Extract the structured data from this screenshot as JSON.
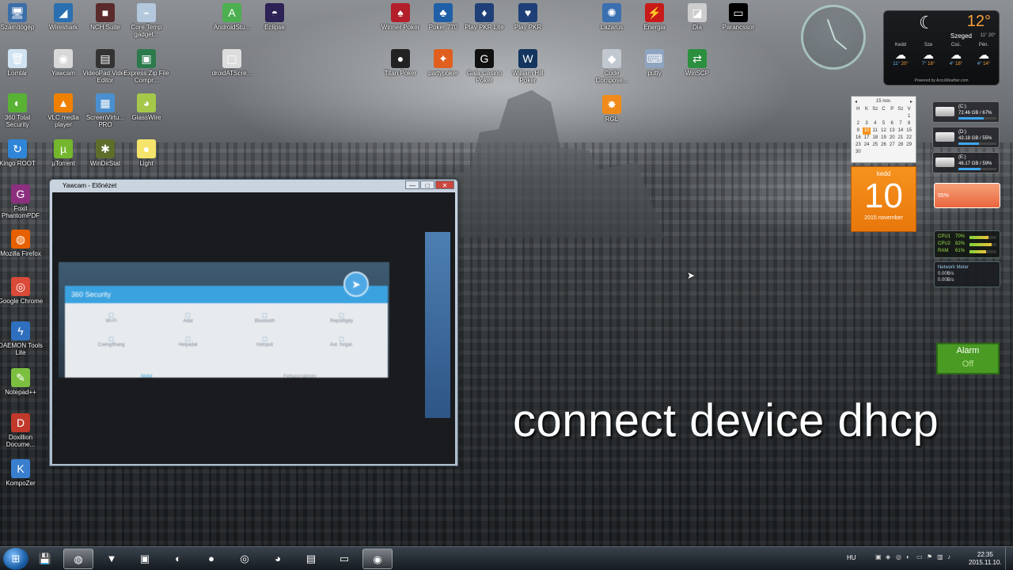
{
  "desktop_icons": [
    {
      "label": "Számítógép",
      "icon": "computer-icon",
      "glyph": "🖥",
      "color": "#3b6ea8"
    },
    {
      "label": "Wireshark",
      "icon": "wireshark-icon",
      "glyph": "◢",
      "color": "#2a6fb0"
    },
    {
      "label": "NCH Suite",
      "icon": "nch-suite-icon",
      "glyph": "■",
      "color": "#5b2a2a"
    },
    {
      "label": "Core Temp gadget...",
      "icon": "core-temp-icon",
      "glyph": "⌁",
      "color": "#b3c7dd"
    },
    {
      "label": "Lomtár",
      "icon": "recycle-bin-icon",
      "glyph": "🗑",
      "color": "#cfe3f2"
    },
    {
      "label": "Yawcam",
      "icon": "yawcam-icon",
      "glyph": "◉",
      "color": "#d8d8d8"
    },
    {
      "label": "VideoPad Video Editor",
      "icon": "videopad-icon",
      "glyph": "▤",
      "color": "#333"
    },
    {
      "label": "Express Zip File Compr...",
      "icon": "express-zip-icon",
      "glyph": "▣",
      "color": "#2b7a4b"
    },
    {
      "label": "360 Total Security",
      "icon": "security-360-icon",
      "glyph": "◐",
      "color": "#59b234"
    },
    {
      "label": "VLC media player",
      "icon": "vlc-icon",
      "glyph": "▲",
      "color": "#f08000"
    },
    {
      "label": "ScreenVirtu... PRO",
      "icon": "screenvirtuoso-icon",
      "glyph": "▦",
      "color": "#4a8fd0"
    },
    {
      "label": "GlassWire",
      "icon": "glasswire-icon",
      "glyph": "◕",
      "color": "#a5c84a"
    },
    {
      "label": "Kingo ROOT",
      "icon": "kingo-root-icon",
      "glyph": "↻",
      "color": "#2f86d8"
    },
    {
      "label": "µTorrent",
      "icon": "utorrent-icon",
      "glyph": "µ",
      "color": "#74b72e"
    },
    {
      "label": "WinDirStat",
      "icon": "windirstat-icon",
      "glyph": "✱",
      "color": "#5c6e2a"
    },
    {
      "label": "Light",
      "icon": "lightbulb-icon",
      "glyph": "●",
      "color": "#f5e46b"
    },
    {
      "label": "Foxit PhantomPDF",
      "icon": "foxit-icon",
      "glyph": "G",
      "color": "#8c2f7e"
    },
    {
      "label": "Mozilla Firefox",
      "icon": "firefox-icon",
      "glyph": "◍",
      "color": "#e66000"
    },
    {
      "label": "Google Chrome",
      "icon": "chrome-icon",
      "glyph": "◎",
      "color": "#d94a38"
    },
    {
      "label": "DAEMON Tools Lite",
      "icon": "daemon-tools-icon",
      "glyph": "ϟ",
      "color": "#2f6fbf"
    },
    {
      "label": "Notepad++",
      "icon": "notepad-plus-icon",
      "glyph": "✎",
      "color": "#7cbf40"
    },
    {
      "label": "Doxillion Docume...",
      "icon": "doxillion-icon",
      "glyph": "D",
      "color": "#c0392b"
    },
    {
      "label": "KompoZer",
      "icon": "kompozer-icon",
      "glyph": "K",
      "color": "#3a7fcf"
    },
    {
      "label": "AndroidStu...",
      "icon": "android-studio-icon",
      "glyph": "A",
      "color": "#4caf50"
    },
    {
      "label": "Eclipse",
      "icon": "eclipse-icon",
      "glyph": "◓",
      "color": "#2c2255"
    },
    {
      "label": "droidATScre...",
      "icon": "droidatscreen-icon",
      "glyph": "▢",
      "color": "#ddd"
    },
    {
      "label": "Winner Poker",
      "icon": "winner-poker-icon",
      "glyph": "♠",
      "color": "#b21e2a"
    },
    {
      "label": "Poker 770",
      "icon": "poker-770-icon",
      "glyph": "♣",
      "color": "#1f5fa8"
    },
    {
      "label": "Play PKR Lite",
      "icon": "pkr-lite-icon",
      "glyph": "♦",
      "color": "#1f3f78"
    },
    {
      "label": "Play PKR",
      "icon": "pkr-icon",
      "glyph": "♥",
      "color": "#1f3f78"
    },
    {
      "label": "Titan Poker",
      "icon": "titan-poker-icon",
      "glyph": "●",
      "color": "#222"
    },
    {
      "label": "partypoker",
      "icon": "partypoker-icon",
      "glyph": "✦",
      "color": "#e05f1f"
    },
    {
      "label": "Gala Casino Poker",
      "icon": "gala-casino-icon",
      "glyph": "G",
      "color": "#111"
    },
    {
      "label": "William Hill Poker",
      "icon": "william-hill-icon",
      "glyph": "W",
      "color": "#13355f"
    },
    {
      "label": "Lazarus",
      "icon": "lazarus-icon",
      "glyph": "✺",
      "color": "#3a6fb0"
    },
    {
      "label": "Energia",
      "icon": "energia-icon",
      "glyph": "⚡",
      "color": "#c91a1a"
    },
    {
      "label": "Dia",
      "icon": "dia-icon",
      "glyph": "◪",
      "color": "#ccc"
    },
    {
      "label": "Parancssor",
      "icon": "command-prompt-icon",
      "glyph": "▭",
      "color": "#000"
    },
    {
      "label": "Code Compose...",
      "icon": "code-composer-icon",
      "glyph": "◆",
      "color": "#c2c8d0"
    },
    {
      "label": "putty",
      "icon": "putty-icon",
      "glyph": "⌨",
      "color": "#8fa4c0"
    },
    {
      "label": "WinSCP",
      "icon": "winscp-icon",
      "glyph": "⇄",
      "color": "#2b8f3e"
    },
    {
      "label": "RGL",
      "icon": "rgl-icon",
      "glyph": "✸",
      "color": "#f08a1a"
    }
  ],
  "yawcam": {
    "title": "Yawcam - Előnézet",
    "minimize": "—",
    "maximize": "□",
    "close": "✕",
    "security_title": "360 Security",
    "security_items": [
      "Wi-Fi",
      "Adat",
      "Bluetooth",
      "Repülőgép",
      "Csengőhang",
      "Helyadat",
      "Hotspot",
      "Aut. forgat."
    ],
    "footer_left": "Mobil",
    "footer_right": "Felhasználónév"
  },
  "weather": {
    "city": "Szeged",
    "temp": "12°",
    "range": "11° 20°",
    "days": [
      {
        "name": "Kedd",
        "lo": "11°",
        "hi": "20°"
      },
      {
        "name": "Sze",
        "lo": "7°",
        "hi": "18°"
      },
      {
        "name": "Csü.",
        "lo": "4°",
        "hi": "18°"
      },
      {
        "name": "Pén.",
        "lo": "4°",
        "hi": "14°"
      }
    ],
    "powered": "Powered by AccuWeather.com"
  },
  "calendar": {
    "month": "15 nov.",
    "prev": "◂",
    "next": "▸",
    "headers": [
      "H",
      "K",
      "Sz",
      "C",
      "P",
      "Sz",
      "V"
    ],
    "days": [
      "",
      "",
      "",
      "",
      "",
      "",
      "1",
      "2",
      "3",
      "4",
      "5",
      "6",
      "7",
      "8",
      "9",
      "10",
      "11",
      "12",
      "13",
      "14",
      "15",
      "16",
      "17",
      "18",
      "19",
      "20",
      "21",
      "22",
      "23",
      "24",
      "25",
      "26",
      "27",
      "28",
      "29",
      "30"
    ],
    "today": "10"
  },
  "daybox": {
    "weekday": "kedd",
    "day": "10",
    "month_year": "2015 november"
  },
  "drives": [
    {
      "label": "(C:)",
      "size": "72.46 GB / 67%",
      "fill": 0.67
    },
    {
      "label": "(D:)",
      "size": "43.18 GB / 55%",
      "fill": 0.55
    },
    {
      "label": "(E:)",
      "size": "46.17 GB / 59%",
      "fill": 0.59
    }
  ],
  "battery": {
    "percent": "55%"
  },
  "cpu": [
    {
      "label": "CPU1",
      "value": "70%",
      "fill": 0.7
    },
    {
      "label": "CPU2",
      "value": "82%",
      "fill": 0.82
    },
    {
      "label": "RAM",
      "value": "61%",
      "fill": 0.61
    }
  ],
  "network": {
    "title": "Network Meter",
    "down": "0.00B/s",
    "up": "0.00B/s"
  },
  "alarm": {
    "label": "Alarm",
    "state": "Off"
  },
  "caption": "connect device dhcp",
  "taskbar": {
    "apps": [
      {
        "icon": "save-icon",
        "glyph": "💾"
      },
      {
        "icon": "firefox-icon",
        "glyph": "◍"
      },
      {
        "icon": "foxit-icon",
        "glyph": "▼"
      },
      {
        "icon": "chest-icon",
        "glyph": "▣"
      },
      {
        "icon": "security-360-icon",
        "glyph": "◐"
      },
      {
        "icon": "lightbulb-icon",
        "glyph": "●"
      },
      {
        "icon": "chrome-icon",
        "glyph": "◎"
      },
      {
        "icon": "glasswire-icon",
        "glyph": "◕"
      },
      {
        "icon": "notepad-icon",
        "glyph": "▤"
      },
      {
        "icon": "command-prompt-icon",
        "glyph": "▭"
      },
      {
        "icon": "yawcam-icon",
        "glyph": "◉"
      }
    ],
    "lang": "HU",
    "time": "22:35",
    "date": "2015.11.10."
  }
}
